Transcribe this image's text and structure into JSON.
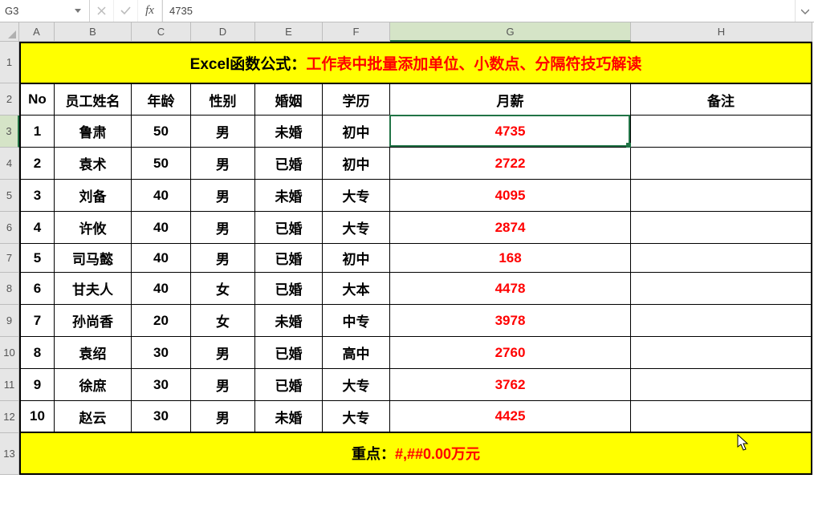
{
  "name_box": "G3",
  "formula_value": "4735",
  "col_headers": [
    "A",
    "B",
    "C",
    "D",
    "E",
    "F",
    "G",
    "H"
  ],
  "row_headers": [
    "1",
    "2",
    "3",
    "4",
    "5",
    "6",
    "7",
    "8",
    "9",
    "10",
    "11",
    "12",
    "13"
  ],
  "banner": {
    "black": "Excel函数公式：",
    "red": "工作表中批量添加单位、小数点、分隔符技巧解读"
  },
  "headers": [
    "No",
    "员工姓名",
    "年龄",
    "性别",
    "婚姻",
    "学历",
    "月薪",
    "备注"
  ],
  "rows": [
    {
      "no": "1",
      "name": "鲁肃",
      "age": "50",
      "gender": "男",
      "marriage": "未婚",
      "edu": "初中",
      "salary": "4735",
      "note": ""
    },
    {
      "no": "2",
      "name": "袁术",
      "age": "50",
      "gender": "男",
      "marriage": "已婚",
      "edu": "初中",
      "salary": "2722",
      "note": ""
    },
    {
      "no": "3",
      "name": "刘备",
      "age": "40",
      "gender": "男",
      "marriage": "未婚",
      "edu": "大专",
      "salary": "4095",
      "note": ""
    },
    {
      "no": "4",
      "name": "许攸",
      "age": "40",
      "gender": "男",
      "marriage": "已婚",
      "edu": "大专",
      "salary": "2874",
      "note": ""
    },
    {
      "no": "5",
      "name": "司马懿",
      "age": "40",
      "gender": "男",
      "marriage": "已婚",
      "edu": "初中",
      "salary": "168",
      "note": ""
    },
    {
      "no": "6",
      "name": "甘夫人",
      "age": "40",
      "gender": "女",
      "marriage": "已婚",
      "edu": "大本",
      "salary": "4478",
      "note": ""
    },
    {
      "no": "7",
      "name": "孙尚香",
      "age": "20",
      "gender": "女",
      "marriage": "未婚",
      "edu": "中专",
      "salary": "3978",
      "note": ""
    },
    {
      "no": "8",
      "name": "袁绍",
      "age": "30",
      "gender": "男",
      "marriage": "已婚",
      "edu": "高中",
      "salary": "2760",
      "note": ""
    },
    {
      "no": "9",
      "name": "徐庶",
      "age": "30",
      "gender": "男",
      "marriage": "已婚",
      "edu": "大专",
      "salary": "3762",
      "note": ""
    },
    {
      "no": "10",
      "name": "赵云",
      "age": "30",
      "gender": "男",
      "marriage": "未婚",
      "edu": "大专",
      "salary": "4425",
      "note": ""
    }
  ],
  "footer": {
    "black": "重点：",
    "red": "#,##0.00万元"
  },
  "selected_cell": "G3"
}
